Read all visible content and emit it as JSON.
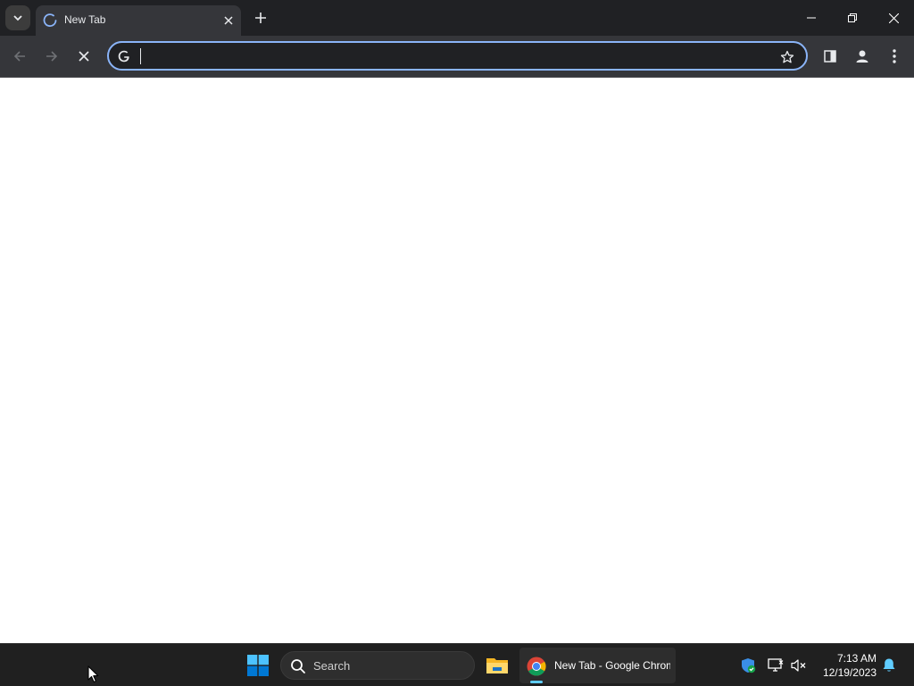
{
  "browser": {
    "tab": {
      "title": "New Tab"
    },
    "omnibox": {
      "value": "",
      "placeholder": ""
    },
    "accent_color": "#8ab4f8"
  },
  "icons": {
    "tab_search": "chevron-down-icon",
    "tab_loading": "spinner-icon",
    "tab_close": "close-icon",
    "new_tab": "plus-icon",
    "back": "back-arrow-icon",
    "forward": "forward-arrow-icon",
    "stop": "stop-icon",
    "omnibox_search": "google-g-icon",
    "bookmark": "star-icon",
    "side_panel": "side-panel-icon",
    "profile": "profile-icon",
    "menu": "kebab-menu-icon"
  },
  "taskbar": {
    "search_label": "Search",
    "chrome_app_label": "New Tab - Google Chrome",
    "time": "7:13 AM",
    "date": "12/19/2023",
    "indicator_color": "#60cdff"
  }
}
